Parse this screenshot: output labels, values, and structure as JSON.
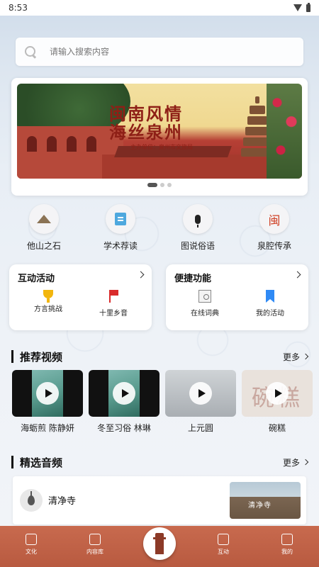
{
  "status_bar": {
    "time": "8:53"
  },
  "search": {
    "placeholder": "请输入搜索内容"
  },
  "banner": {
    "title_line1": "闽南风情",
    "title_line2": "海丝泉州",
    "subtitle": "主办单位：泉州市文旅局",
    "page_count": 3,
    "active_page": 1
  },
  "quick_links": [
    {
      "label": "他山之石",
      "icon": "mountain-icon"
    },
    {
      "label": "学术荐读",
      "icon": "book-icon"
    },
    {
      "label": "图说俗语",
      "icon": "microphone-icon"
    },
    {
      "label": "泉腔传承",
      "icon": "min-character-icon",
      "glyph": "闽"
    }
  ],
  "interactive": {
    "title": "互动活动",
    "items": [
      {
        "label": "方言挑战",
        "icon": "trophy-icon"
      },
      {
        "label": "十里乡音",
        "icon": "flag-icon"
      }
    ]
  },
  "shortcuts": {
    "title": "便捷功能",
    "items": [
      {
        "label": "在线词典",
        "icon": "dictionary-icon"
      },
      {
        "label": "我的活动",
        "icon": "bookmark-icon"
      }
    ]
  },
  "videos": {
    "title": "推荐视频",
    "more": "更多",
    "items": [
      {
        "caption": "海蛎煎 陈静妍"
      },
      {
        "caption": "冬至习俗 林琳"
      },
      {
        "caption": "上元圆"
      },
      {
        "caption": "碗糕",
        "thumb_text": "碗糕"
      }
    ]
  },
  "audio": {
    "title": "精选音频",
    "more": "更多",
    "items": [
      {
        "name": "清净寺",
        "thumb_text": "清净寺"
      }
    ]
  },
  "tabbar": {
    "tabs": [
      {
        "label": "文化"
      },
      {
        "label": "内容库"
      },
      {
        "label": "互动"
      },
      {
        "label": "我的"
      }
    ]
  },
  "colors": {
    "tabbar": "#c0634a",
    "accent_red": "#d92b2b",
    "accent_blue": "#2f8af5",
    "accent_gold": "#f2b60e"
  }
}
